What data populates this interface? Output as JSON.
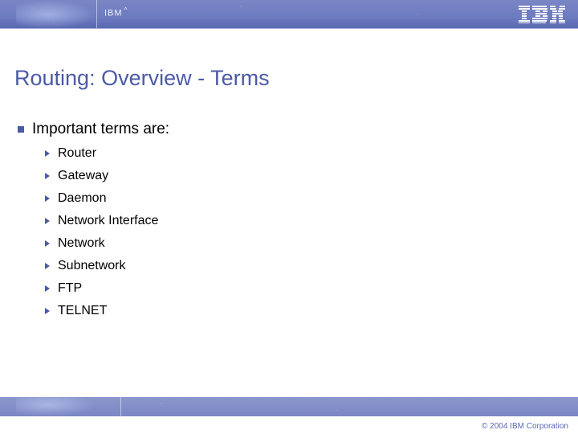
{
  "header": {
    "brand_small": "IBM",
    "brand_caret": "^"
  },
  "title": "Routing: Overview - Terms",
  "bullet_heading": "Important terms are:",
  "terms": [
    "Router",
    "Gateway",
    "Daemon",
    "Network Interface",
    "Network",
    "Subnetwork",
    "FTP",
    "TELNET"
  ],
  "footer": {
    "copyright": "© 2004 IBM Corporation"
  },
  "colors": {
    "accent": "#4b5aa6",
    "banner": "#7a86c4"
  }
}
